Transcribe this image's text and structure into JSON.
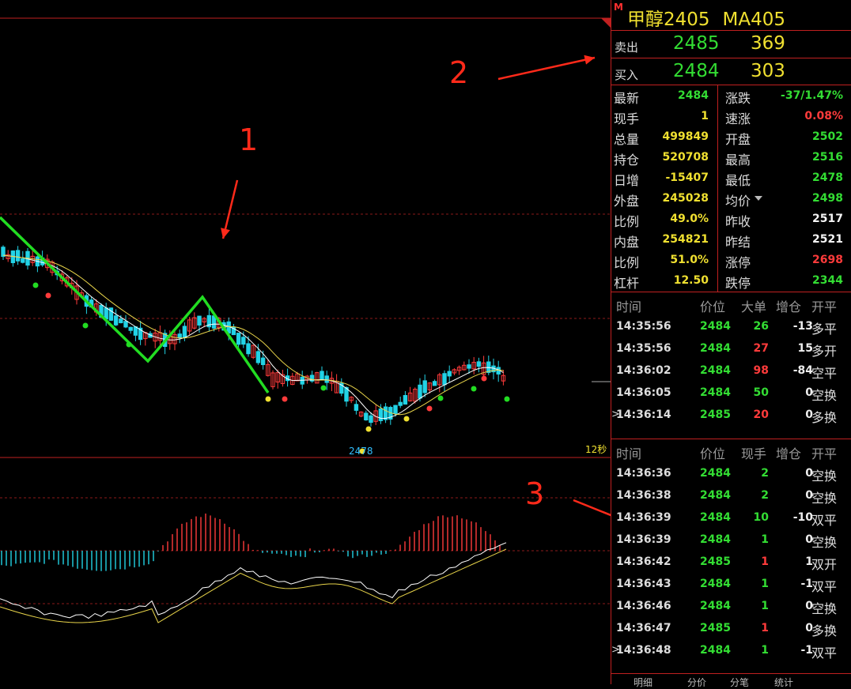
{
  "header": {
    "marker": "M",
    "name": "甲醇2405",
    "code": "MA405"
  },
  "orderbook": {
    "ask": {
      "label": "卖出",
      "price": "2485",
      "volume": "369"
    },
    "bid": {
      "label": "买入",
      "price": "2484",
      "volume": "303"
    }
  },
  "stats": [
    {
      "l1": "最新",
      "v1": "2484",
      "c1": "g",
      "l2": "涨跌",
      "v2": "-37/1.47%",
      "c2": "g"
    },
    {
      "l1": "现手",
      "v1": "1",
      "c1": "y",
      "l2": "速涨",
      "v2": "0.08%",
      "c2": "r"
    },
    {
      "l1": "总量",
      "v1": "499849",
      "c1": "y",
      "l2": "开盘",
      "v2": "2502",
      "c2": "g"
    },
    {
      "l1": "持仓",
      "v1": "520708",
      "c1": "y",
      "l2": "最高",
      "v2": "2516",
      "c2": "g"
    },
    {
      "l1": "日增",
      "v1": "-15407",
      "c1": "y",
      "l2": "最低",
      "v2": "2478",
      "c2": "g"
    },
    {
      "l1": "外盘",
      "v1": "245028",
      "c1": "y",
      "l2": "均价",
      "v2": "2498",
      "c2": "g"
    },
    {
      "l1": "比例",
      "v1": "49.0%",
      "c1": "y",
      "l2": "昨收",
      "v2": "2517",
      "c2": "w"
    },
    {
      "l1": "内盘",
      "v1": "254821",
      "c1": "y",
      "l2": "昨结",
      "v2": "2521",
      "c2": "w"
    },
    {
      "l1": "比例",
      "v1": "51.0%",
      "c1": "y",
      "l2": "涨停",
      "v2": "2698",
      "c2": "r"
    },
    {
      "l1": "杠杆",
      "v1": "12.50",
      "c1": "y",
      "l2": "跌停",
      "v2": "2344",
      "c2": "g"
    }
  ],
  "tape_big": {
    "headers": [
      "时间",
      "价位",
      "大单",
      "增仓",
      "开平"
    ],
    "rows": [
      {
        "t": "14:35:56",
        "p": "2484",
        "q": "26",
        "qc": "g",
        "c": "-13",
        "k": "多平",
        "mk": ""
      },
      {
        "t": "14:35:56",
        "p": "2484",
        "q": "27",
        "qc": "r",
        "c": "15",
        "k": "多开",
        "mk": ""
      },
      {
        "t": "14:36:02",
        "p": "2484",
        "q": "98",
        "qc": "r",
        "c": "-84",
        "k": "空平",
        "mk": ""
      },
      {
        "t": "14:36:05",
        "p": "2484",
        "q": "50",
        "qc": "g",
        "c": "0",
        "k": "空换",
        "mk": ""
      },
      {
        "t": "14:36:14",
        "p": "2485",
        "q": "20",
        "qc": "r",
        "c": "0",
        "k": "多换",
        "mk": ">"
      }
    ]
  },
  "tape_ticks": {
    "headers": [
      "时间",
      "价位",
      "现手",
      "增仓",
      "开平"
    ],
    "rows": [
      {
        "t": "14:36:36",
        "p": "2484",
        "pc": "g",
        "q": "2",
        "qc": "g",
        "c": "0",
        "k": "空换",
        "mk": ""
      },
      {
        "t": "14:36:38",
        "p": "2484",
        "pc": "g",
        "q": "2",
        "qc": "g",
        "c": "0",
        "k": "空换",
        "mk": ""
      },
      {
        "t": "14:36:39",
        "p": "2484",
        "pc": "g",
        "q": "10",
        "qc": "g",
        "c": "-10",
        "k": "双平",
        "mk": ""
      },
      {
        "t": "14:36:39",
        "p": "2484",
        "pc": "g",
        "q": "1",
        "qc": "g",
        "c": "0",
        "k": "空换",
        "mk": ""
      },
      {
        "t": "14:36:42",
        "p": "2485",
        "pc": "g",
        "q": "1",
        "qc": "r",
        "c": "1",
        "k": "双开",
        "mk": ""
      },
      {
        "t": "14:36:43",
        "p": "2484",
        "pc": "g",
        "q": "1",
        "qc": "g",
        "c": "-1",
        "k": "双平",
        "mk": ""
      },
      {
        "t": "14:36:46",
        "p": "2484",
        "pc": "g",
        "q": "1",
        "qc": "g",
        "c": "0",
        "k": "空换",
        "mk": ""
      },
      {
        "t": "14:36:47",
        "p": "2485",
        "pc": "g",
        "q": "1",
        "qc": "r",
        "c": "0",
        "k": "多换",
        "mk": ""
      },
      {
        "t": "14:36:48",
        "p": "2484",
        "pc": "g",
        "q": "1",
        "qc": "g",
        "c": "-1",
        "k": "双平",
        "mk": ">"
      }
    ]
  },
  "chart": {
    "low_label": "2478",
    "timer_label": "12秒",
    "annotations": [
      "1",
      "2",
      "3"
    ],
    "bottom_tabs": [
      "明细",
      "分价",
      "分笔",
      "统计"
    ],
    "colors": {
      "up": "#ff3b3b",
      "down": "#22d3e6",
      "trend": "#22dd22",
      "grid": "#8b1a1a",
      "arrow": "#ff2a1a"
    }
  }
}
